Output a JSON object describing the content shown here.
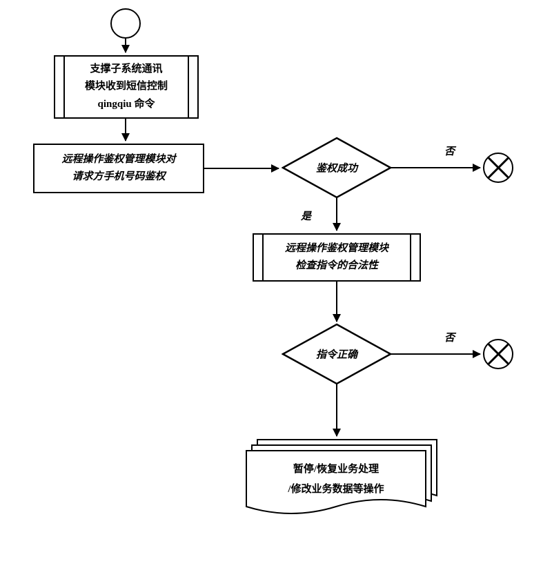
{
  "chart_data": {
    "type": "flowchart",
    "nodes": [
      {
        "id": "start",
        "kind": "start"
      },
      {
        "id": "p1",
        "kind": "process",
        "text": "支撑子系统通讯\n模块收到短信控制\nqingqiu    命令"
      },
      {
        "id": "p2",
        "kind": "process",
        "text": "远程操作鉴权管理模块对\n请求方手机号码鉴权"
      },
      {
        "id": "d1",
        "kind": "decision",
        "text": "鉴权成功"
      },
      {
        "id": "end1",
        "kind": "terminator"
      },
      {
        "id": "p3",
        "kind": "process",
        "text": "远程操作鉴权管理模块\n检查指令的合法性"
      },
      {
        "id": "d2",
        "kind": "decision",
        "text": "指令正确"
      },
      {
        "id": "end2",
        "kind": "terminator"
      },
      {
        "id": "doc",
        "kind": "document",
        "text": "暂停/恢复业务处理\n/修改业务数据等操作"
      }
    ],
    "edges": [
      {
        "from": "start",
        "to": "p1"
      },
      {
        "from": "p1",
        "to": "p2"
      },
      {
        "from": "p2",
        "to": "d1"
      },
      {
        "from": "d1",
        "to": "end1",
        "label": "否"
      },
      {
        "from": "d1",
        "to": "p3",
        "label": "是"
      },
      {
        "from": "p3",
        "to": "d2"
      },
      {
        "from": "d2",
        "to": "end2",
        "label": "否"
      },
      {
        "from": "d2",
        "to": "doc"
      }
    ]
  },
  "labels": {
    "yes": "是",
    "no": "否"
  },
  "nodes": {
    "p1": "支撑子系统通讯\n模块收到短信控制\nqingqiu    命令",
    "p2": "远程操作鉴权管理模块对\n请求方手机号码鉴权",
    "d1": "鉴权成功",
    "p3": "远程操作鉴权管理模块\n检查指令的合法性",
    "d2": "指令正确",
    "doc": "暂停/恢复业务处理\n/修改业务数据等操作"
  }
}
